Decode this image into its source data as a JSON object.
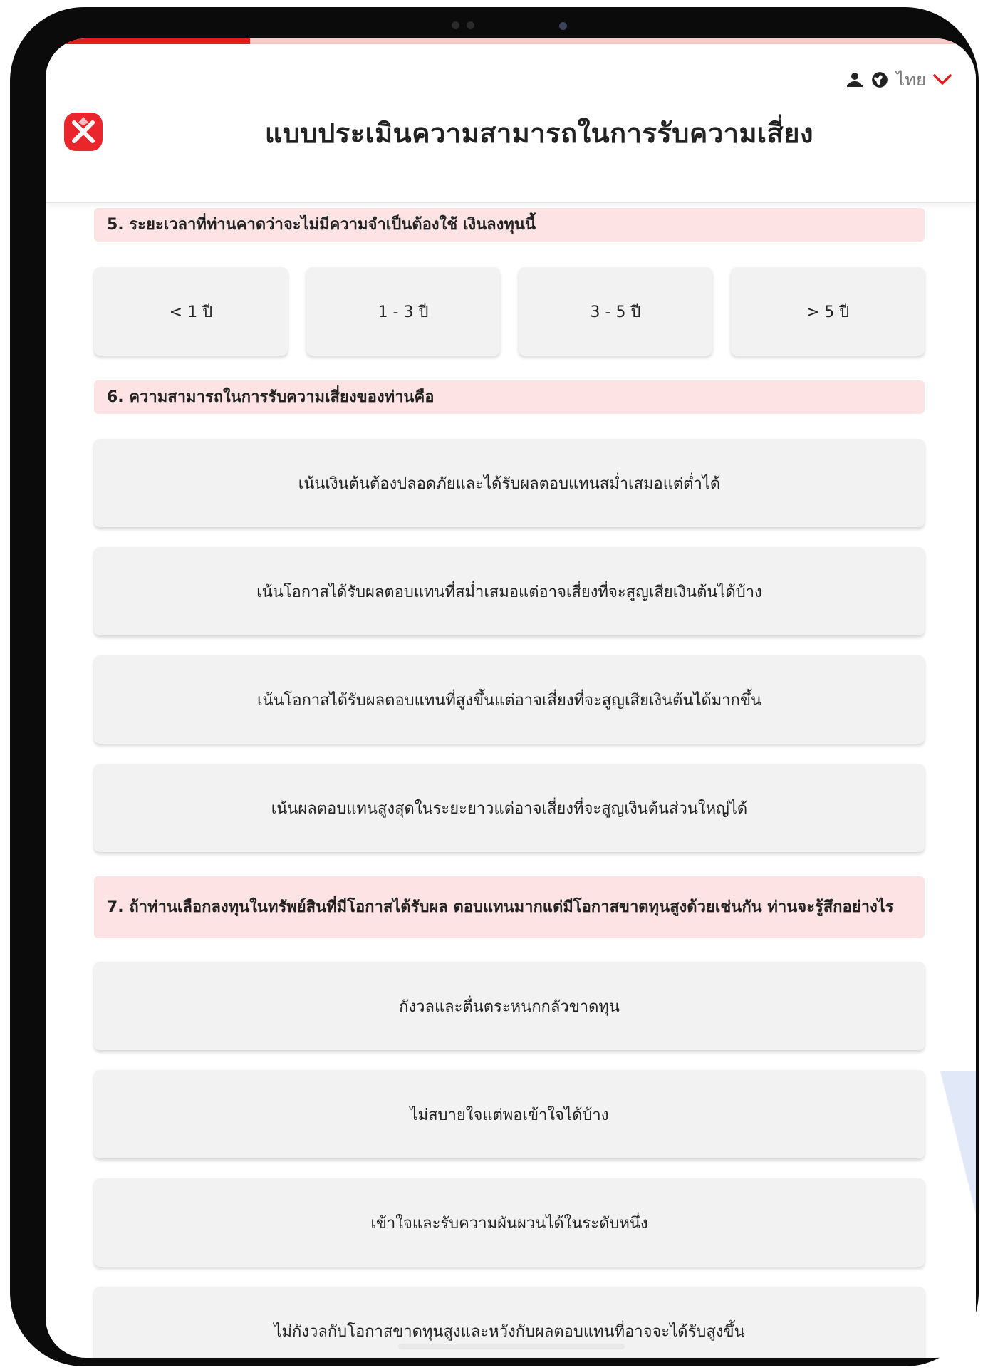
{
  "header": {
    "title": "แบบประเมินความสามารถในการรับความเสี่ยง",
    "language": "ไทย",
    "progress_fraction": 0.22
  },
  "colors": {
    "accent": "#e11d1d",
    "question_bg": "#fde3e3",
    "answer_bg": "#f2f2f2"
  },
  "icons": [
    "user-icon",
    "globe-icon",
    "chevron-down-icon",
    "logo-icon"
  ],
  "questions": [
    {
      "label": "5. ระยะเวลาที่ท่านคาดว่าจะไม่มีความจำเป็นต้องใช้ เงินลงทุนนี้",
      "options": [
        "< 1 ปี",
        "1 - 3 ปี",
        "3 - 5 ปี",
        "> 5 ปี"
      ]
    },
    {
      "label": "6. ความสามารถในการรับความเสี่ยงของท่านคือ",
      "options": [
        "เน้นเงินต้นต้องปลอดภัยและได้รับผลตอบแทนสม่ำเสมอแต่ต่ำได้",
        "เน้นโอกาสได้รับผลตอบแทนที่สม่ำเสมอแต่อาจเสี่ยงที่จะสูญเสียเงินต้นได้บ้าง",
        "เน้นโอกาสได้รับผลตอบแทนที่สูงขึ้นแต่อาจเสี่ยงที่จะสูญเสียเงินต้นได้มากขึ้น",
        "เน้นผลตอบแทนสูงสุดในระยะยาวแต่อาจเสี่ยงที่จะสูญเงินต้นส่วนใหญ่ได้"
      ]
    },
    {
      "label": "7. ถ้าท่านเลือกลงทุนในทรัพย์สินที่มีโอกาสได้รับผล ตอบแทนมากแต่มีโอกาสขาดทุนสูงด้วยเช่นกัน ท่านจะรู้สึกอย่างไร",
      "options": [
        "กังวลและตื่นตระหนกกลัวขาดทุน",
        "ไม่สบายใจแต่พอเข้าใจได้บ้าง",
        "เข้าใจและรับความผันผวนได้ในระดับหนึ่ง",
        "ไม่กังวลกับโอกาสขาดทุนสูงและหวังกับผลตอบแทนที่อาจจะได้รับสูงขึ้น"
      ]
    }
  ]
}
